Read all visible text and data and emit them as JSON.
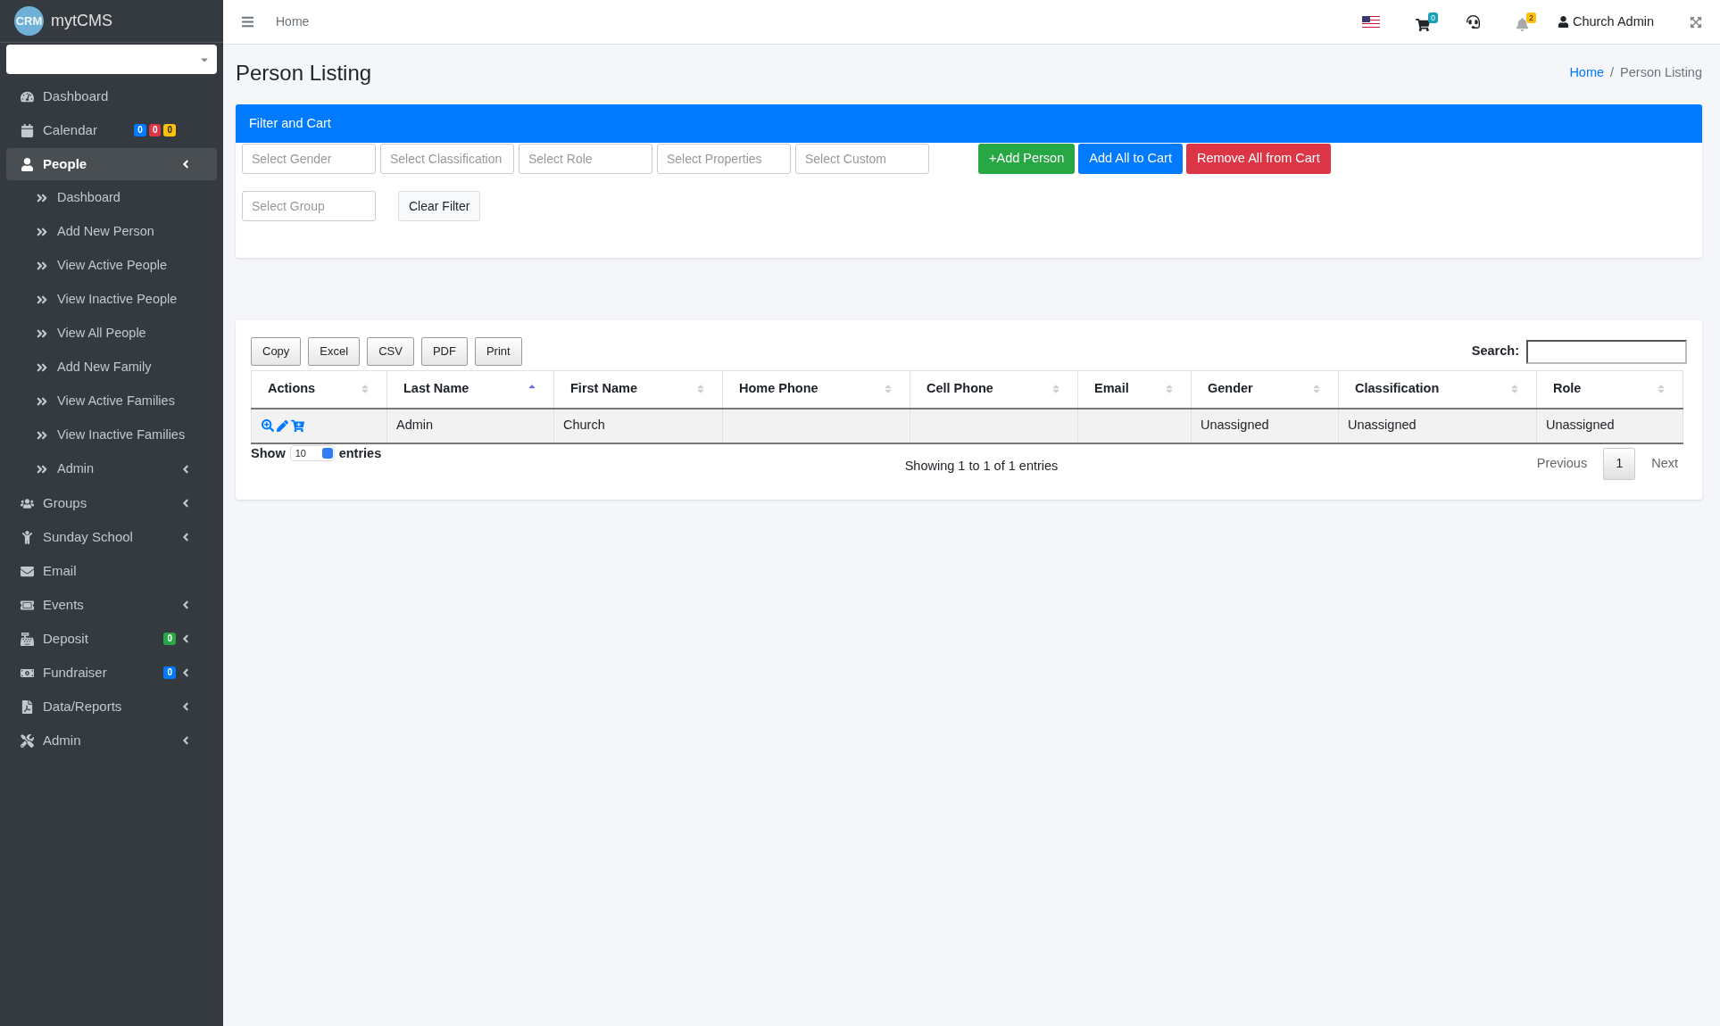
{
  "brand": {
    "logo": "CRM",
    "name": "mytCMS"
  },
  "sidebar": {
    "items": [
      {
        "label": "Dashboard",
        "selected": false,
        "expandable": false
      },
      {
        "label": "Calendar",
        "selected": false,
        "expandable": false,
        "badges": [
          {
            "text": "0",
            "color": "#007bff"
          },
          {
            "text": "0",
            "color": "#dc3545"
          },
          {
            "text": "0",
            "color": "#ffc107"
          }
        ]
      },
      {
        "label": "People",
        "selected": true,
        "expandable": true,
        "children": [
          {
            "label": "Dashboard",
            "expandable": false
          },
          {
            "label": "Add New Person",
            "expandable": false
          },
          {
            "label": "View Active People",
            "expandable": false
          },
          {
            "label": "View Inactive People",
            "expandable": false
          },
          {
            "label": "View All People",
            "expandable": false
          },
          {
            "label": "Add New Family",
            "expandable": false
          },
          {
            "label": "View Active Families",
            "expandable": false
          },
          {
            "label": "View Inactive Families",
            "expandable": false
          },
          {
            "label": "Admin",
            "expandable": true
          }
        ]
      },
      {
        "label": "Groups",
        "selected": false,
        "expandable": true
      },
      {
        "label": "Sunday School",
        "selected": false,
        "expandable": true
      },
      {
        "label": "Email",
        "selected": false,
        "expandable": false
      },
      {
        "label": "Events",
        "selected": false,
        "expandable": true
      },
      {
        "label": "Deposit",
        "selected": false,
        "expandable": true,
        "badges": [
          {
            "text": "0",
            "color": "#28a745"
          }
        ]
      },
      {
        "label": "Fundraiser",
        "selected": false,
        "expandable": true,
        "badges": [
          {
            "text": "0",
            "color": "#007bff"
          }
        ]
      },
      {
        "label": "Data/Reports",
        "selected": false,
        "expandable": true
      },
      {
        "label": "Admin",
        "selected": false,
        "expandable": true
      }
    ]
  },
  "topbar": {
    "home_link": "Home",
    "cart_count": "0",
    "notification_count": "2",
    "user": "Church Admin"
  },
  "page": {
    "title": "Person Listing",
    "breadcrumb_separator": "/",
    "breadcrumb": [
      {
        "label": "Home",
        "selected": false
      },
      {
        "label": "Person Listing",
        "selected": true
      }
    ]
  },
  "filter": {
    "title": "Filter and Cart",
    "selects": [
      "Select Gender",
      "Select Classification",
      "Select Role",
      "Select Properties",
      "Select Custom"
    ],
    "buttons": [
      {
        "label": "+Add Person",
        "color": "#28a745"
      },
      {
        "label": "Add All to Cart",
        "color": "#007bff"
      },
      {
        "label": "Remove All from Cart",
        "color": "#dc3545"
      }
    ],
    "group_select": "Select Group",
    "clear_button": "Clear Filter"
  },
  "table": {
    "export_buttons": [
      "Copy",
      "Excel",
      "CSV",
      "PDF",
      "Print"
    ],
    "search_label": "Search:",
    "columns": [
      {
        "label": "Actions",
        "sorted": false
      },
      {
        "label": "Last Name",
        "sorted": true
      },
      {
        "label": "First Name",
        "sorted": false
      },
      {
        "label": "Home Phone",
        "sorted": false
      },
      {
        "label": "Cell Phone",
        "sorted": false
      },
      {
        "label": "Email",
        "sorted": false
      },
      {
        "label": "Gender",
        "sorted": false
      },
      {
        "label": "Classification",
        "sorted": false
      },
      {
        "label": "Role",
        "sorted": false
      }
    ],
    "rows": [
      {
        "cells": [
          "",
          "Admin",
          "Church",
          "",
          "",
          "",
          "Unassigned",
          "Unassigned",
          "Unassigned"
        ]
      }
    ],
    "show_label": "Show",
    "page_size": "10",
    "entries_label": "entries",
    "info": "Showing 1 to 1 of 1 entries",
    "pagination": [
      {
        "label": "Previous",
        "kind": "nav"
      },
      {
        "label": "1",
        "kind": "page"
      },
      {
        "label": "Next",
        "kind": "nav"
      }
    ]
  }
}
